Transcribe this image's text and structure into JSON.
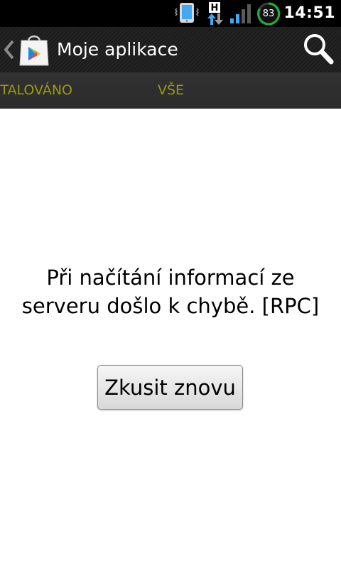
{
  "status_bar": {
    "time": "14:51",
    "battery_level": "83",
    "network_type": "H",
    "icons": [
      "vibrate-icon",
      "hspa-data-icon",
      "signal-icon",
      "battery-icon"
    ],
    "colors": {
      "battery_ring": "#1fae3d",
      "signal": "#3fa9f5",
      "vibrate": "#3fa9f5"
    }
  },
  "action_bar": {
    "title": "Moje aplikace",
    "icons": [
      "up-chevron-icon",
      "play-store-icon",
      "search-icon"
    ]
  },
  "tabs": [
    {
      "label": "Nainstalováno",
      "selected": false
    },
    {
      "label": "Vše",
      "selected": true
    }
  ],
  "tab_text_color": "#9a9a14",
  "content": {
    "error_message": "Při načítání informací ze serveru došlo k chybě. [RPC]",
    "retry_button_label": "Zkusit znovu"
  }
}
